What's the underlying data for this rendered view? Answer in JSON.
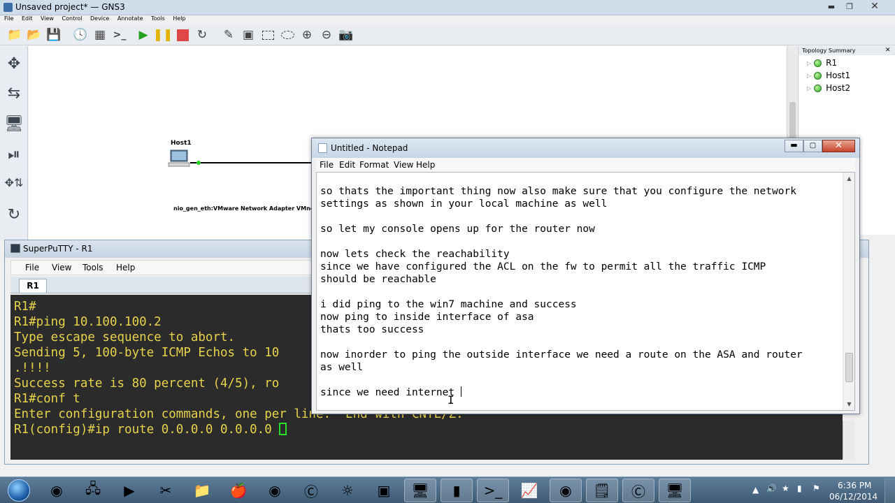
{
  "gns3": {
    "title": "Unsaved project* — GNS3",
    "menu": [
      "File",
      "Edit",
      "View",
      "Control",
      "Device",
      "Annotate",
      "Tools",
      "Help"
    ],
    "toolbar_icons": [
      "open-folder-icon",
      "open-project-icon",
      "save-icon",
      "snapshot-icon",
      "console-all-icon",
      "terminal-icon",
      "start-icon",
      "pause-icon",
      "stop-icon",
      "reload-icon",
      "note-icon",
      "image-icon",
      "rectangle-icon",
      "ellipse-icon",
      "zoom-in-icon",
      "zoom-out-icon",
      "screenshot-icon"
    ],
    "sidebar_icons": [
      "routers-icon",
      "switches-icon",
      "end-devices-icon",
      "security-devices-icon",
      "all-devices-icon",
      "add-link-icon"
    ],
    "nodes": {
      "host1_label": "Host1",
      "nio_label": "nio_gen_eth:VMware Network Adapter VMne"
    },
    "topology": {
      "header": "Topology Summary",
      "items": [
        "R1",
        "Host1",
        "Host2"
      ]
    }
  },
  "putty": {
    "title": "SuperPuTTY - R1",
    "menu": [
      "File",
      "View",
      "Tools",
      "Help"
    ],
    "tab": "R1",
    "lines": [
      "R1#",
      "R1#ping 10.100.100.2",
      "",
      "Type escape sequence to abort.",
      "Sending 5, 100-byte ICMP Echos to 10",
      ".!!!!",
      "Success rate is 80 percent (4/5), ro",
      "R1#conf t",
      "Enter configuration commands, one per line.  End with CNTL/Z.",
      "R1(config)#ip route 0.0.0.0 0.0.0.0 "
    ]
  },
  "notepad": {
    "title": "Untitled - Notepad",
    "menu": [
      "File",
      "Edit",
      "Format",
      "View",
      "Help"
    ],
    "lines": [
      "so thats the important thing now also make sure that you configure the network",
      "settings as shown in your local machine as well",
      "",
      "so let my console opens up for the router now",
      "",
      "now lets check the reachability",
      "since we have configured the ACL on the fw to permit all the traffic ICMP",
      "should be reachable",
      "",
      "i did ping to the win7 machine and success",
      "now ping to inside interface of asa",
      "thats too success",
      "",
      "now inorder to ping the outside interface we need a route on the ASA and router",
      "as well",
      "",
      "since we need internet "
    ]
  },
  "taskbar": {
    "apps": [
      "chrome-icon",
      "network-icon",
      "media-player-icon",
      "snipping-tool-icon",
      "explorer-icon",
      "fruit-app-icon",
      "firefox-icon",
      "skype-icon",
      "gns3-icon",
      "store-icon",
      "remote-desktop-icon",
      "cmd-icon",
      "powershell-icon",
      "monitor-icon",
      "camtasia-recorder-icon",
      "notepad-icon",
      "camtasia-icon",
      "superputty-icon"
    ],
    "time": "6:36 PM",
    "date": "06/12/2014"
  }
}
